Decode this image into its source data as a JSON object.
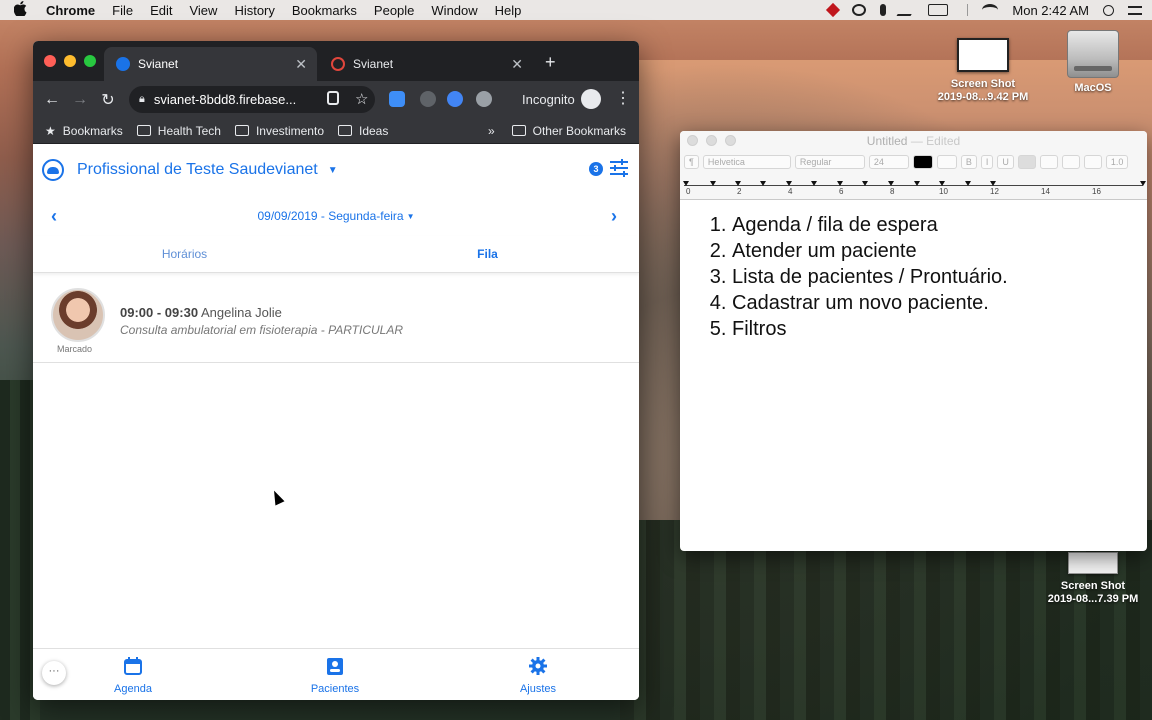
{
  "menubar": {
    "app_name": "Chrome",
    "items": [
      "File",
      "Edit",
      "View",
      "History",
      "Bookmarks",
      "People",
      "Window",
      "Help"
    ],
    "clock": "Mon 2:42 AM"
  },
  "desktop": {
    "icons": [
      {
        "label_line1": "Screen Shot",
        "label_line2": "2019-08...9.42 PM"
      },
      {
        "label_line1": "MacOS",
        "label_line2": ""
      },
      {
        "label_line1": "Screen Shot",
        "label_line2": "2019-08...7.39 PM"
      }
    ]
  },
  "chrome": {
    "tabs": [
      {
        "title": "Svianet",
        "active": true
      },
      {
        "title": "Svianet",
        "active": false
      }
    ],
    "url": "svianet-8bdd8.firebase...",
    "incognito_label": "Incognito",
    "bookmarks": [
      "Bookmarks",
      "Health Tech",
      "Investimento",
      "Ideas"
    ],
    "other_bookmarks": "Other Bookmarks",
    "overflow": "»"
  },
  "app": {
    "professional": "Profissional de Teste Saudevianet",
    "filter_count": "3",
    "date": "09/09/2019 - Segunda-feira",
    "tabs": [
      {
        "label": "Horários",
        "active": false
      },
      {
        "label": "Fila",
        "active": true
      }
    ],
    "appointment": {
      "time": "09:00 - 09:30",
      "patient": "Angelina Jolie",
      "description": "Consulta ambulatorial em fisioterapia - PARTICULAR",
      "status": "Marcado"
    },
    "more": "···",
    "bottom_nav": [
      {
        "label": "Agenda",
        "icon": "calendar-icon"
      },
      {
        "label": "Pacientes",
        "icon": "contacts-icon"
      },
      {
        "label": "Ajustes",
        "icon": "gear-icon"
      }
    ]
  },
  "textedit": {
    "title": "Untitled",
    "edited": "— Edited",
    "font": "Helvetica",
    "style": "Regular",
    "size": "24",
    "spacing": "1.0",
    "list": [
      "Agenda / fila de espera",
      "Atender um paciente",
      "Lista de pacientes / Prontuário.",
      "Cadastrar um novo paciente.",
      "Filtros"
    ],
    "ruler_numbers": [
      "0",
      "2",
      "4",
      "6",
      "8",
      "10",
      "12",
      "14",
      "16"
    ]
  },
  "colors": {
    "accent": "#1a73e8",
    "chrome_dark": "#202124",
    "chrome_toolbar": "#35363a"
  }
}
